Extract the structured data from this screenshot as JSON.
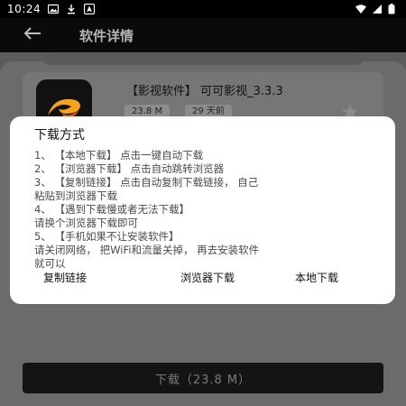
{
  "status_bar": {
    "time": "10:24",
    "icons": [
      "image-icon",
      "download-icon",
      "navigation-icon"
    ],
    "right_icons": [
      "wifi-icon",
      "signal-icon",
      "battery-icon"
    ]
  },
  "app_bar": {
    "title": "软件详情",
    "back_icon": "arrow-left-icon"
  },
  "app": {
    "name": "【影视软件】 可可影视_3.3.3",
    "size": "23.8 M",
    "date": "29 天前",
    "icon": "video-app-logo"
  },
  "download_button": {
    "label": "下载（23.8 M）"
  },
  "dialog": {
    "title": "下载方式",
    "lines": [
      "1、 【本地下载】 点击一键自动下载",
      "2、 【浏览器下载】 点击自动跳转浏览器",
      "3、 【复制链接】 点击自动复制下载链接， 自己",
      "粘贴到浏览器下载",
      "4、 【遇到下载慢或者无法下载】",
      "请换个浏览器下载即可",
      "5、 【手机如果不让安装软件】",
      "请关闭网络， 把WiFi和流量关掉， 再去安装软件",
      "就可以"
    ],
    "actions": {
      "copy": "复制链接",
      "browser": "浏览器下载",
      "local": "本地下载"
    }
  },
  "colors": {
    "overlay": "#5b5b5b",
    "dialog_bg": "#ffffff",
    "status_bar_bg": "#000000"
  }
}
